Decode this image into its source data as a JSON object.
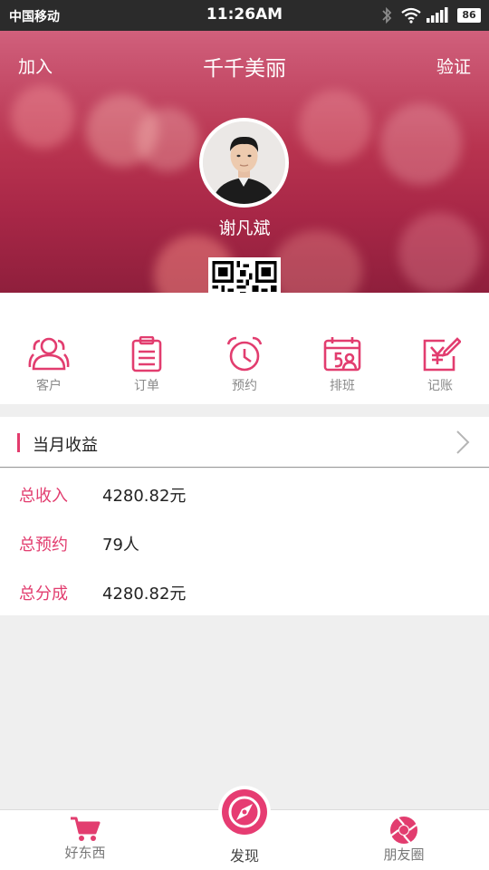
{
  "status_bar": {
    "carrier": "中国移动",
    "time": "11:26AM",
    "battery": "86",
    "icons": [
      "bluetooth-icon",
      "wifi-icon",
      "signal-icon",
      "battery-icon"
    ]
  },
  "header": {
    "left_action": "加入",
    "title": "千千美丽",
    "right_action": "验证"
  },
  "profile": {
    "name": "谢凡斌"
  },
  "quick_menu": {
    "items": [
      {
        "label": "客户",
        "icon": "customers-icon"
      },
      {
        "label": "订单",
        "icon": "orders-icon"
      },
      {
        "label": "预约",
        "icon": "alarm-clock-icon"
      },
      {
        "label": "排班",
        "icon": "schedule-icon"
      },
      {
        "label": "记账",
        "icon": "bookkeeping-icon"
      }
    ]
  },
  "income": {
    "title": "当月收益",
    "rows": [
      {
        "label": "总收入",
        "value": "4280.82元"
      },
      {
        "label": "总预约",
        "value": "79人"
      },
      {
        "label": "总分成",
        "value": "4280.82元"
      }
    ]
  },
  "tab_bar": {
    "tabs": [
      {
        "label": "好东西",
        "icon": "cart-icon"
      },
      {
        "label": "发现",
        "icon": "compass-icon"
      },
      {
        "label": "朋友圈",
        "icon": "aperture-icon"
      }
    ]
  },
  "colors": {
    "accent": "#e33b6d",
    "status_bar": "#2b2b2b",
    "hero": "#b8334f",
    "background": "#efefef"
  }
}
